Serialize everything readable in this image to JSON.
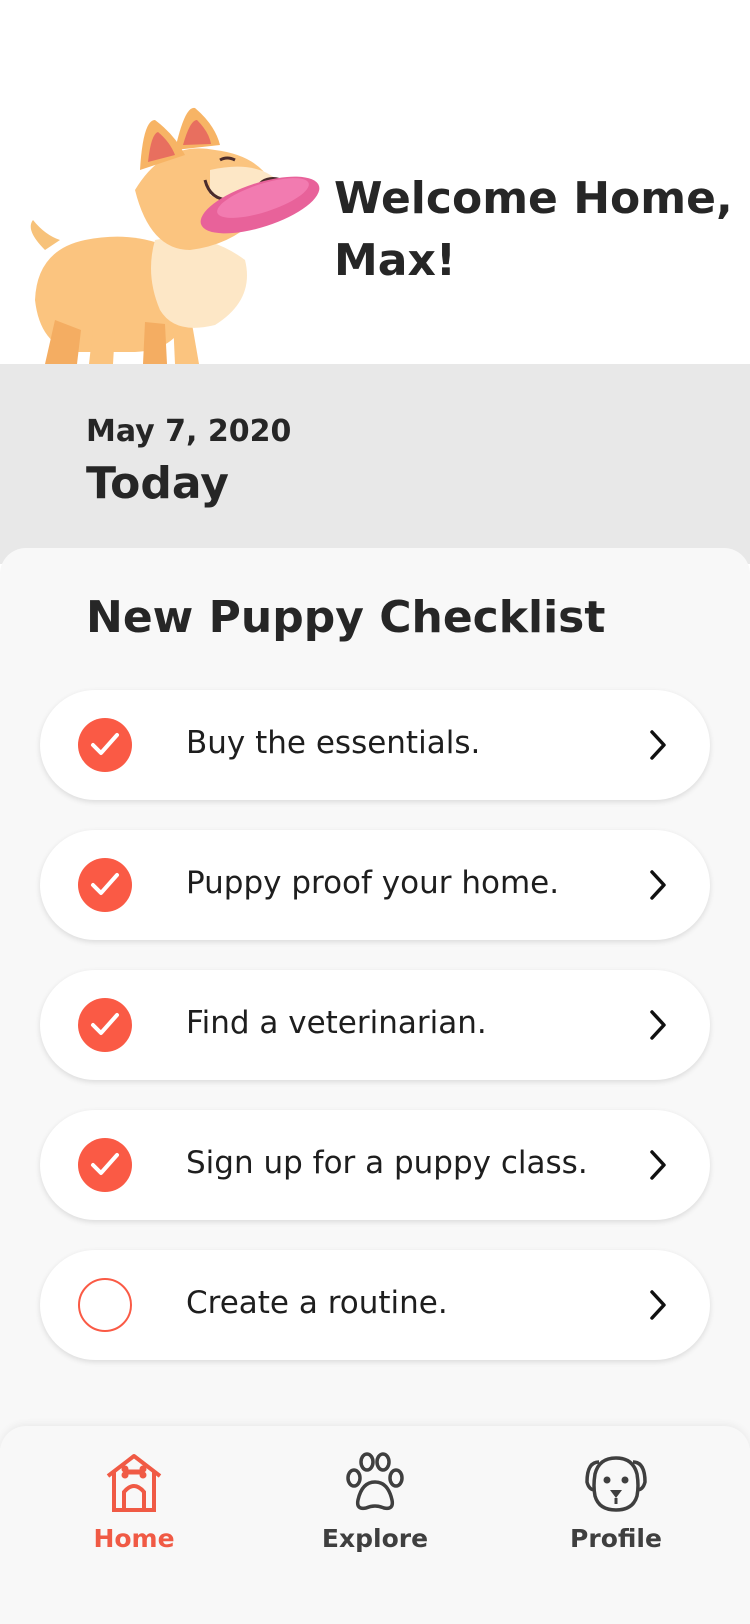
{
  "header": {
    "welcome": "Welcome Home, Max!"
  },
  "today": {
    "date": "May 7, 2020",
    "title": "Today"
  },
  "checklist": {
    "title": "New Puppy Checklist",
    "items": [
      {
        "label": "Buy the essentials.",
        "done": true
      },
      {
        "label": "Puppy proof your home.",
        "done": true
      },
      {
        "label": "Find a veterinarian.",
        "done": true
      },
      {
        "label": "Sign up for a puppy class.",
        "done": true
      },
      {
        "label": "Create a routine.",
        "done": false
      }
    ]
  },
  "nav": {
    "items": [
      {
        "label": "Home",
        "icon": "doghouse-icon",
        "active": true
      },
      {
        "label": "Explore",
        "icon": "paw-icon",
        "active": false
      },
      {
        "label": "Profile",
        "icon": "dog-face-icon",
        "active": false
      }
    ]
  },
  "colors": {
    "accent": "#fa5a45",
    "background": "#f8f8f8",
    "date_band": "#e8e8e8",
    "text": "#262626"
  }
}
